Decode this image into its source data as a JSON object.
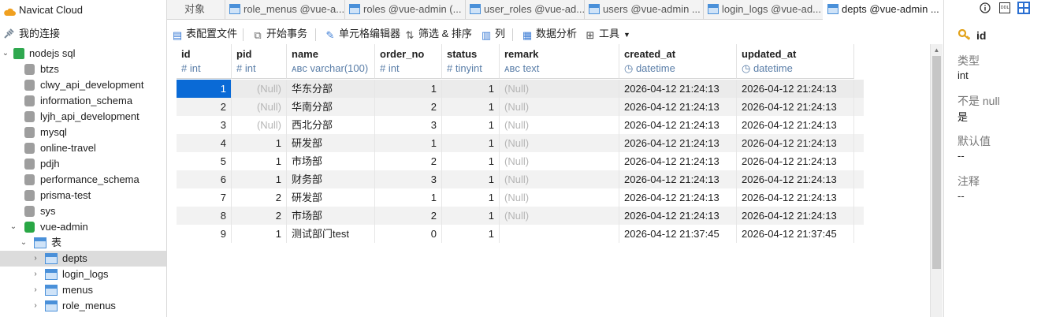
{
  "sidebar": {
    "cloud": "Navicat Cloud",
    "my_connections": "我的连接",
    "connection": "nodejs sql",
    "databases": [
      "btzs",
      "clwy_api_development",
      "information_schema",
      "lyjh_api_development",
      "mysql",
      "online-travel",
      "pdjh",
      "performance_schema",
      "prisma-test",
      "sys",
      "vue-admin"
    ],
    "tables_folder": "表",
    "tables": [
      "depts",
      "login_logs",
      "menus",
      "role_menus"
    ]
  },
  "tabs": [
    {
      "label": "对象",
      "icon": false
    },
    {
      "label": "role_menus @vue-a...",
      "icon": true
    },
    {
      "label": "roles @vue-admin (...",
      "icon": true
    },
    {
      "label": "user_roles @vue-ad...",
      "icon": true
    },
    {
      "label": "users @vue-admin ...",
      "icon": true
    },
    {
      "label": "login_logs @vue-ad...",
      "icon": true
    },
    {
      "label": "depts @vue-admin ...",
      "icon": true,
      "active": true
    }
  ],
  "toolbar": {
    "table_config": "表配置文件",
    "begin_tx": "开始事务",
    "cell_editor": "单元格编辑器",
    "filter_sort": "筛选 & 排序",
    "columns": "列",
    "data_analysis": "数据分析",
    "tools": "工具"
  },
  "grid": {
    "columns": [
      {
        "name": "id",
        "type": "# int"
      },
      {
        "name": "pid",
        "type": "# int"
      },
      {
        "name": "name",
        "type": "ᴀʙᴄ varchar(100)"
      },
      {
        "name": "order_no",
        "type": "# int"
      },
      {
        "name": "status",
        "type": "# tinyint"
      },
      {
        "name": "remark",
        "type": "ᴀʙᴄ text"
      },
      {
        "name": "created_at",
        "type": "◷ datetime"
      },
      {
        "name": "updated_at",
        "type": "◷ datetime"
      }
    ],
    "rows": [
      [
        "1",
        "(Null)",
        "华东分部",
        "1",
        "1",
        "(Null)",
        "2026-04-12 21:24:13",
        "2026-04-12 21:24:13"
      ],
      [
        "2",
        "(Null)",
        "华南分部",
        "2",
        "1",
        "(Null)",
        "2026-04-12 21:24:13",
        "2026-04-12 21:24:13"
      ],
      [
        "3",
        "(Null)",
        "西北分部",
        "3",
        "1",
        "(Null)",
        "2026-04-12 21:24:13",
        "2026-04-12 21:24:13"
      ],
      [
        "4",
        "1",
        "研发部",
        "1",
        "1",
        "(Null)",
        "2026-04-12 21:24:13",
        "2026-04-12 21:24:13"
      ],
      [
        "5",
        "1",
        "市场部",
        "2",
        "1",
        "(Null)",
        "2026-04-12 21:24:13",
        "2026-04-12 21:24:13"
      ],
      [
        "6",
        "1",
        "财务部",
        "3",
        "1",
        "(Null)",
        "2026-04-12 21:24:13",
        "2026-04-12 21:24:13"
      ],
      [
        "7",
        "2",
        "研发部",
        "1",
        "1",
        "(Null)",
        "2026-04-12 21:24:13",
        "2026-04-12 21:24:13"
      ],
      [
        "8",
        "2",
        "市场部",
        "2",
        "1",
        "(Null)",
        "2026-04-12 21:24:13",
        "2026-04-12 21:24:13"
      ],
      [
        "9",
        "1",
        "测试部门test",
        "0",
        "1",
        "",
        "2026-04-12 21:37:45",
        "2026-04-12 21:37:45"
      ]
    ]
  },
  "panel": {
    "field": "id",
    "type_label": "类型",
    "type_value": "int",
    "notnull_label": "不是 null",
    "notnull_value": "是",
    "default_label": "默认值",
    "default_value": "--",
    "comment_label": "注释",
    "comment_value": "--"
  },
  "colors": {
    "selection": "#0a6ad6",
    "accent": "#3a7bd5"
  }
}
